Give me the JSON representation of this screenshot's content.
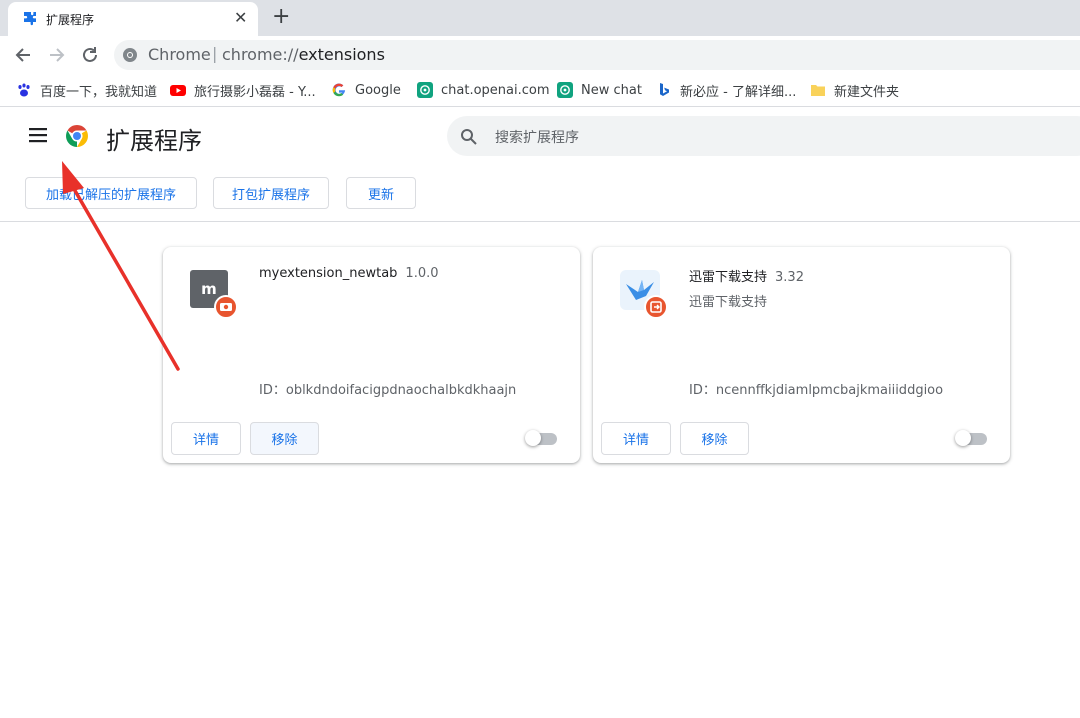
{
  "browser": {
    "tab": {
      "title": "扩展程序",
      "close_label": "✕"
    },
    "new_tab_label": "+",
    "omnibox": {
      "site_label": "Chrome",
      "separator": "|",
      "url_scheme": "chrome://",
      "url_path": "extensions"
    }
  },
  "bookmarks": [
    {
      "label": "百度一下，我就知道",
      "icon": "baidu-icon"
    },
    {
      "label": "旅行摄影小磊磊 - Y...",
      "icon": "youtube-icon"
    },
    {
      "label": "Google",
      "icon": "google-icon"
    },
    {
      "label": "chat.openai.com",
      "icon": "openai-icon"
    },
    {
      "label": "New chat",
      "icon": "openai-icon"
    },
    {
      "label": "新必应 - 了解详细...",
      "icon": "bing-icon"
    },
    {
      "label": "新建文件夹",
      "icon": "folder-icon"
    }
  ],
  "header": {
    "title": "扩展程序",
    "search_placeholder": "搜索扩展程序"
  },
  "dev_toolbar": {
    "load_unpacked": "加载已解压的扩展程序",
    "pack": "打包扩展程序",
    "update": "更新"
  },
  "extensions": [
    {
      "name": "myextension_newtab",
      "version": "1.0.0",
      "description": "",
      "icon_letter": "m",
      "id_label": "ID：",
      "id": "oblkdndoifacigpdnaochalbkdkhaajn",
      "details_label": "详情",
      "remove_label": "移除",
      "enabled": false
    },
    {
      "name": "迅雷下载支持",
      "version": "3.32",
      "description": "迅雷下载支持",
      "id_label": "ID：",
      "id": "ncennffkjdiamlpmcbajkmaiiiddgioo",
      "details_label": "详情",
      "remove_label": "移除",
      "enabled": false
    }
  ],
  "colors": {
    "accent": "#1a73e8",
    "annotation_arrow": "#e8312a",
    "extension_badge": "#e8552f"
  }
}
